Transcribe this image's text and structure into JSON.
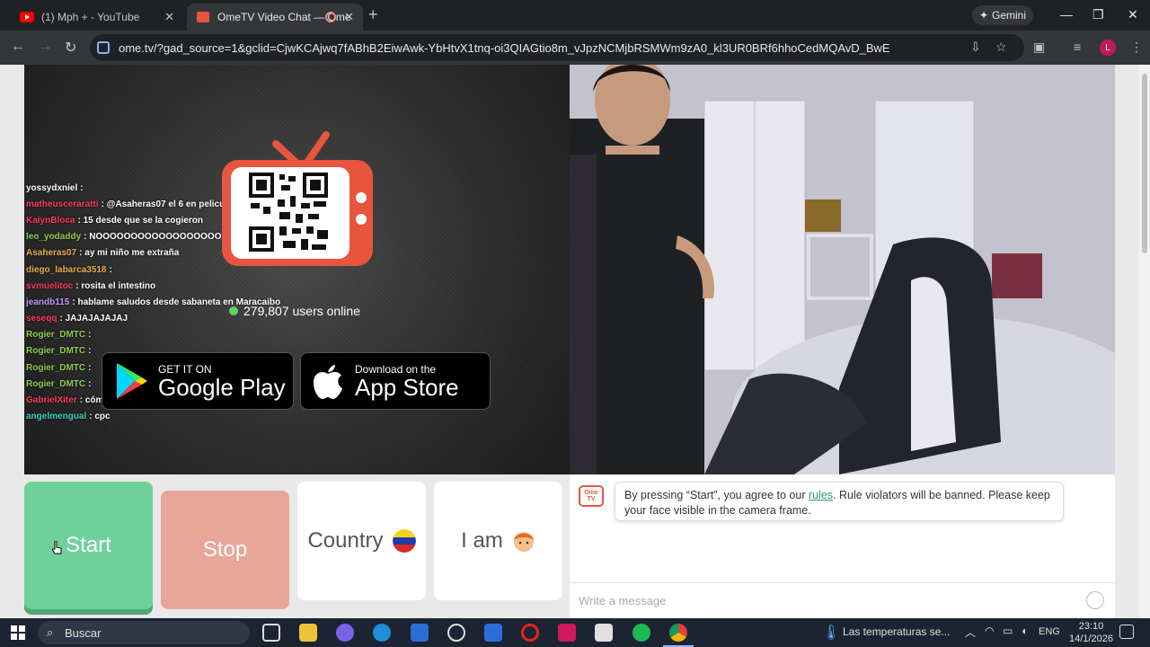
{
  "browser": {
    "tabs": [
      {
        "title": "(1) Mph + - YouTube",
        "active": false
      },
      {
        "title": "OmeTV Video Chat — Ome",
        "active": true
      }
    ],
    "gemini_label": "Gemini",
    "url": "ome.tv/?gad_source=1&gclid=CjwKCAjwq7fABhB2EiwAwk-YbHtvX1tnq-oi3QIAGtio8m_vJpzNCMjbRSMWm9zA0_kl3UR0BRf6hhoCedMQAvD_BwE",
    "profile_initial": "L"
  },
  "left_video": {
    "chat_lines": [
      {
        "user": "yossydxniel",
        "msg": ":",
        "color": "#ffffff"
      },
      {
        "user": "matheusceraratti",
        "msg": ": @Asaheras07 el 6 en pelicula",
        "color": "#ff3b5c"
      },
      {
        "user": "KaiynBloca",
        "msg": ": 15 desde que se la cogieron",
        "color": "#ff3b5c"
      },
      {
        "user": "leo_yodaddy",
        "msg": ": NOOOOOOOOOOOOOOOOOO",
        "color": "#8fd14f"
      },
      {
        "user": "Asaheras07",
        "msg": ": ay mi niño me extraña",
        "color": "#e8b04a"
      },
      {
        "user": "diego_labarca3518",
        "msg": ":",
        "color": "#e8b04a"
      },
      {
        "user": "svmuelitoc",
        "msg": ": rosita el intestino",
        "color": "#ff3b5c"
      },
      {
        "user": "jeandb115",
        "msg": ": hablame saludos desde sabaneta en Maracaibo",
        "color": "#c39bff"
      },
      {
        "user": "seseqq",
        "msg": ": JAJAJAJAJAJ",
        "color": "#ff3b5c"
      },
      {
        "user": "Rogier_DMTC",
        "msg": ":",
        "color": "#8fd14f"
      },
      {
        "user": "Rogier_DMTC",
        "msg": ":",
        "color": "#8fd14f"
      },
      {
        "user": "Rogier_DMTC",
        "msg": ":",
        "color": "#8fd14f"
      },
      {
        "user": "Rogier_DMTC",
        "msg": ":",
        "color": "#8fd14f"
      },
      {
        "user": "GabrielXiter",
        "msg": ": cómo se llama el Tiki toki",
        "color": "#ff3b5c"
      },
      {
        "user": "angelmengual",
        "msg": ": cpc",
        "color": "#3fd1c8"
      }
    ],
    "online_count": "279,807 users online",
    "google_play": {
      "small": "GET IT ON",
      "big": "Google Play"
    },
    "app_store": {
      "small": "Download on the",
      "big": "App Store"
    }
  },
  "controls": {
    "start": "Start",
    "stop": "Stop",
    "country": "Country",
    "iam": "I am"
  },
  "chat_panel": {
    "logo_text": "Ome TV",
    "notice_before": "By pressing “Start”, you agree to our ",
    "notice_link": "rules",
    "notice_after": ". Rule violators will be banned. Please keep your face visible in the camera frame.",
    "input_placeholder": "Write a message"
  },
  "taskbar": {
    "search_placeholder": "Buscar",
    "weather": "Las temperaturas se...",
    "lang": "ENG",
    "time": "23:10",
    "date": "14/1/2026"
  },
  "colors": {
    "start": "#6fd19a",
    "stop": "#e8a699",
    "tv": "#e8553f",
    "online_dot": "#5fd35f"
  }
}
